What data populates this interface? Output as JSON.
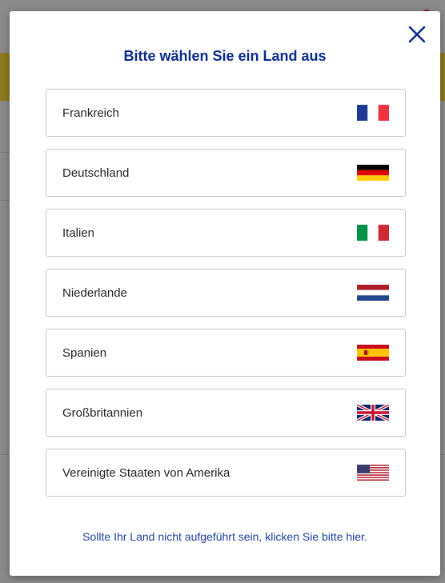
{
  "modal": {
    "title": "Bitte wählen Sie ein Land aus",
    "footer_link": "Sollte Ihr Land nicht aufgeführt sein, klicken Sie bitte hier.",
    "accent_color": "#0a2a8c",
    "link_color": "#1f3fa0"
  },
  "countries": [
    {
      "label": "Frankreich",
      "flag": "france-flag-icon"
    },
    {
      "label": "Deutschland",
      "flag": "germany-flag-icon"
    },
    {
      "label": "Italien",
      "flag": "italy-flag-icon"
    },
    {
      "label": "Niederlande",
      "flag": "netherlands-flag-icon"
    },
    {
      "label": "Spanien",
      "flag": "spain-flag-icon"
    },
    {
      "label": "Großbritannien",
      "flag": "uk-flag-icon"
    },
    {
      "label": "Vereinigte Staaten von Amerika",
      "flag": "usa-flag-icon"
    }
  ]
}
